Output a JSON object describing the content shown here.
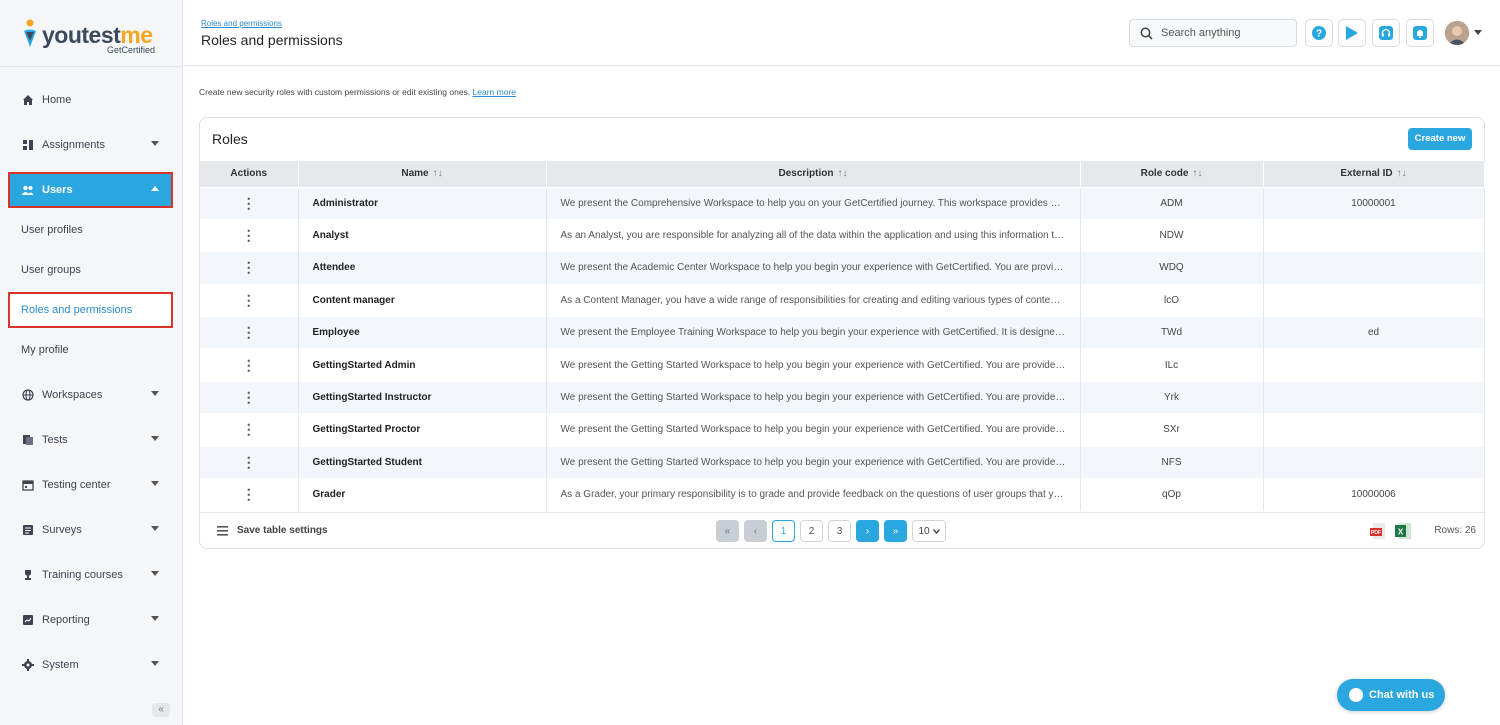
{
  "brand": {
    "name_main": "youtest",
    "name_accent": "me",
    "tagline": "GetCertified"
  },
  "sidebar": {
    "items": [
      {
        "label": "Home",
        "icon": "home-icon"
      },
      {
        "label": "Assignments",
        "icon": "assignments-icon"
      },
      {
        "label": "Users",
        "icon": "users-icon"
      },
      {
        "label": "Workspaces",
        "icon": "globe-icon"
      },
      {
        "label": "Tests",
        "icon": "tests-icon"
      },
      {
        "label": "Testing center",
        "icon": "calendar-icon"
      },
      {
        "label": "Surveys",
        "icon": "survey-icon"
      },
      {
        "label": "Training courses",
        "icon": "trophy-icon"
      },
      {
        "label": "Reporting",
        "icon": "reporting-icon"
      },
      {
        "label": "System",
        "icon": "gear-icon"
      }
    ],
    "users_sub": [
      "User profiles",
      "User groups",
      "Roles and permissions",
      "My profile"
    ],
    "collapse_label": "«"
  },
  "header": {
    "breadcrumb": "Roles and permissions",
    "title": "Roles and permissions",
    "search_placeholder": "Search anything"
  },
  "intro": {
    "text": "Create new security roles with custom permissions or edit existing ones.",
    "link": "Learn more"
  },
  "card": {
    "title": "Roles",
    "create_label": "Create new"
  },
  "table": {
    "columns": [
      "Actions",
      "Name",
      "Description",
      "Role code",
      "External ID"
    ],
    "sort_glyph": "↑↓",
    "action_glyph": "⋮",
    "rows": [
      {
        "name": "Administrator",
        "description": "We present the Comprehensive Workspace to help you on your GetCertified journey. This workspace provides acce...",
        "code": "ADM",
        "ext": "10000001"
      },
      {
        "name": "Analyst",
        "description": "As an Analyst, you are responsible for analyzing all of the data within the application and using this information to ...",
        "code": "NDW",
        "ext": ""
      },
      {
        "name": "Attendee",
        "description": "We present the Academic Center Workspace to help you begin your experience with GetCertified. You are provided...",
        "code": "WDQ",
        "ext": ""
      },
      {
        "name": "Content manager",
        "description": "As a Content Manager, you have a wide range of responsibilities for creating and editing various types of content ...",
        "code": "lcO",
        "ext": ""
      },
      {
        "name": "Employee",
        "description": "We present the Employee Training Workspace to help you begin your experience with GetCertified. It is designed to...",
        "code": "TWd",
        "ext": "ed"
      },
      {
        "name": "GettingStarted Admin",
        "description": "We present the Getting Started Workspace to help you begin your experience with GetCertified. You are provided a ...",
        "code": "ILc",
        "ext": ""
      },
      {
        "name": "GettingStarted Instructor",
        "description": "We present the Getting Started Workspace to help you begin your experience with GetCertified. You are provided a ...",
        "code": "Yrk",
        "ext": ""
      },
      {
        "name": "GettingStarted Proctor",
        "description": "We present the Getting Started Workspace to help you begin your experience with GetCertified. You are provided a ...",
        "code": "SXr",
        "ext": ""
      },
      {
        "name": "GettingStarted Student",
        "description": "We present the Getting Started Workspace to help you begin your experience with GetCertified. You are provided a ...",
        "code": "NFS",
        "ext": ""
      },
      {
        "name": "Grader",
        "description": "As a Grader, your primary responsibility is to grade and provide feedback on the questions of user groups that you ...",
        "code": "qOp",
        "ext": "10000006"
      }
    ]
  },
  "footer": {
    "save_label": "Save table settings",
    "pages": [
      "1",
      "2",
      "3"
    ],
    "first_glyph": "«",
    "prev_glyph": "‹",
    "next_glyph": "›",
    "last_glyph": "»",
    "page_size": "10",
    "rows_label": "Rows: 26"
  },
  "chat": {
    "label": "Chat with us"
  },
  "colors": {
    "accent": "#2ba7e0",
    "highlight": "#d9342b"
  }
}
